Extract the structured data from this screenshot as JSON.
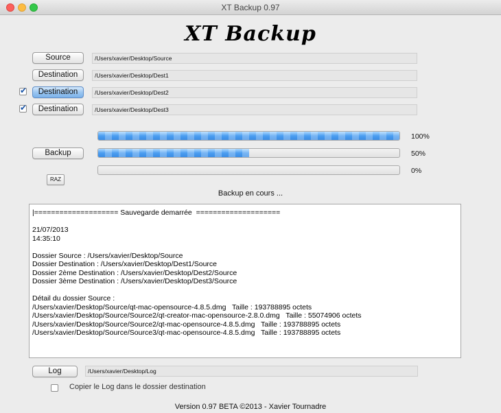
{
  "window": {
    "title": "XT Backup 0.97"
  },
  "app_title": "XT Backup",
  "rows": [
    {
      "button": "Source",
      "path": "/Users/xavier/Desktop/Source",
      "has_checkbox": false,
      "active": false
    },
    {
      "button": "Destination",
      "path": "/Users/xavier/Desktop/Dest1",
      "has_checkbox": false,
      "active": false
    },
    {
      "button": "Destination",
      "path": "/Users/xavier/Desktop/Dest2",
      "has_checkbox": true,
      "checked": true,
      "active": true
    },
    {
      "button": "Destination",
      "path": "/Users/xavier/Desktop/Dest3",
      "has_checkbox": true,
      "checked": true,
      "active": false
    }
  ],
  "checkmark_glyph": "✔",
  "backup_button": "Backup",
  "raz_button": "RAZ",
  "progress": [
    {
      "value": 1.0,
      "label": "100%"
    },
    {
      "value": 0.5,
      "label": "50%"
    },
    {
      "value": 0.0,
      "label": "0%"
    }
  ],
  "status_text": "Backup en cours ...",
  "log_lines": [
    "|==================== Sauvegarde demarrée  ====================",
    "",
    "21/07/2013",
    "14:35:10",
    "",
    "Dossier Source : /Users/xavier/Desktop/Source",
    "Dossier Destination : /Users/xavier/Desktop/Dest1/Source",
    "Dossier 2ème Destination : /Users/xavier/Desktop/Dest2/Source",
    "Dossier 3ème Destination : /Users/xavier/Desktop/Dest3/Source",
    "",
    "Détail du dossier Source :",
    "/Users/xavier/Desktop/Source/qt-mac-opensource-4.8.5.dmg   Taille : 193788895 octets",
    "/Users/xavier/Desktop/Source/Source2/qt-creator-mac-opensource-2.8.0.dmg   Taille : 55074906 octets",
    "/Users/xavier/Desktop/Source/Source2/qt-mac-opensource-4.8.5.dmg   Taille : 193788895 octets",
    "/Users/xavier/Desktop/Source/Source3/qt-mac-opensource-4.8.5.dmg   Taille : 193788895 octets"
  ],
  "log_button": "Log",
  "log_path": "/Users/xavier/Desktop/Log",
  "copy_log_label": "Copier le Log dans le dossier destination",
  "copy_log_checked": false,
  "footer": "Version 0.97 BETA    ©2013 - Xavier Tournadre",
  "colors": {
    "close": "#fc605c",
    "minimize": "#fdbc40",
    "zoom": "#34c84a",
    "progress_fill": "#4b9df0",
    "checkmark": "#1a55a8"
  }
}
